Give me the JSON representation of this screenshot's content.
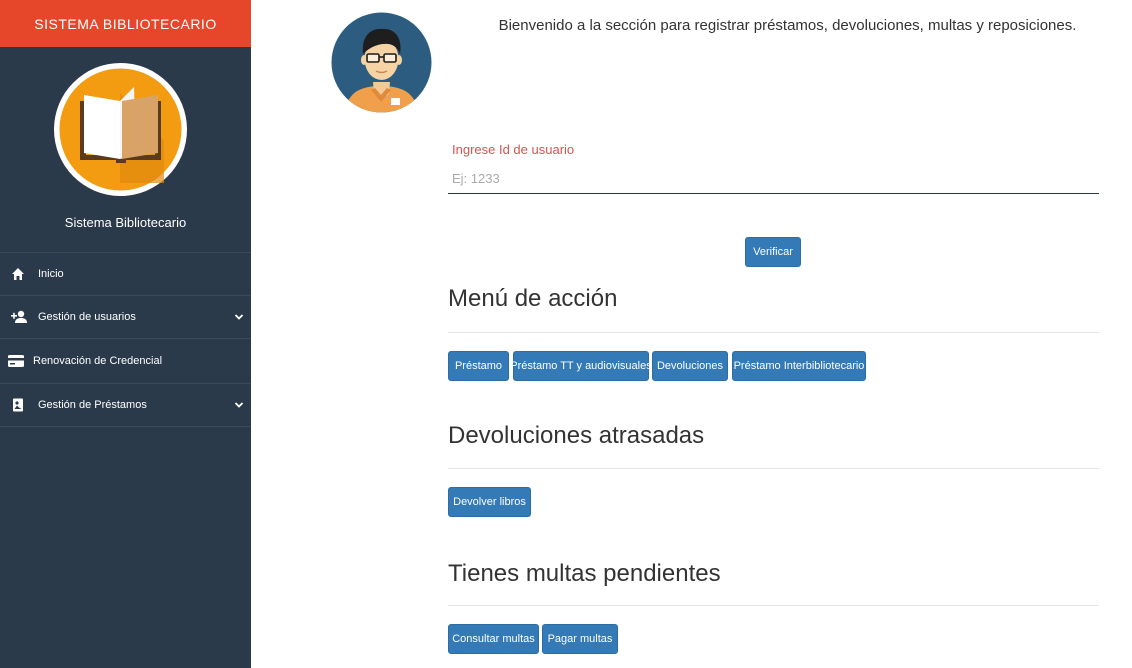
{
  "sidebar": {
    "brand": "SISTEMA BIBLIOTECARIO",
    "logo_icon": "open-book-icon",
    "profile_name": "Sistema Bibliotecario",
    "items": [
      {
        "label": "Inicio",
        "icon": "home-icon",
        "has_submenu": false
      },
      {
        "label": "Gestión de usuarios",
        "icon": "add-user-icon",
        "has_submenu": true
      },
      {
        "label": "Renovación de Credencial",
        "icon": "credit-card-icon",
        "has_submenu": false
      },
      {
        "label": "Gestión de Préstamos",
        "icon": "book-icon",
        "has_submenu": true
      }
    ]
  },
  "main": {
    "avatar_icon": "librarian-avatar-icon",
    "welcome": "Bienvenido a la sección para registrar préstamos, devoluciones, multas y reposiciones.",
    "user_field": {
      "label": "Ingrese Id de usuario",
      "placeholder": "Ej: 1233",
      "value": ""
    },
    "verify_label": "Verificar",
    "action_menu": {
      "title": "Menú de acción",
      "buttons": [
        "Préstamo",
        "Préstamo TT y audiovisuales",
        "Devoluciones",
        "Préstamo Interbibliotecario"
      ]
    },
    "overdue": {
      "title": "Devoluciones atrasadas",
      "button": "Devolver libros"
    },
    "fines": {
      "title": "Tienes multas pendientes",
      "buttons": [
        "Consultar multas",
        "Pagar multas"
      ]
    }
  },
  "colors": {
    "brand": "#e6472a",
    "sidebar": "#2b3a4a",
    "button": "#337ab7",
    "label_accent": "#d9534f"
  }
}
